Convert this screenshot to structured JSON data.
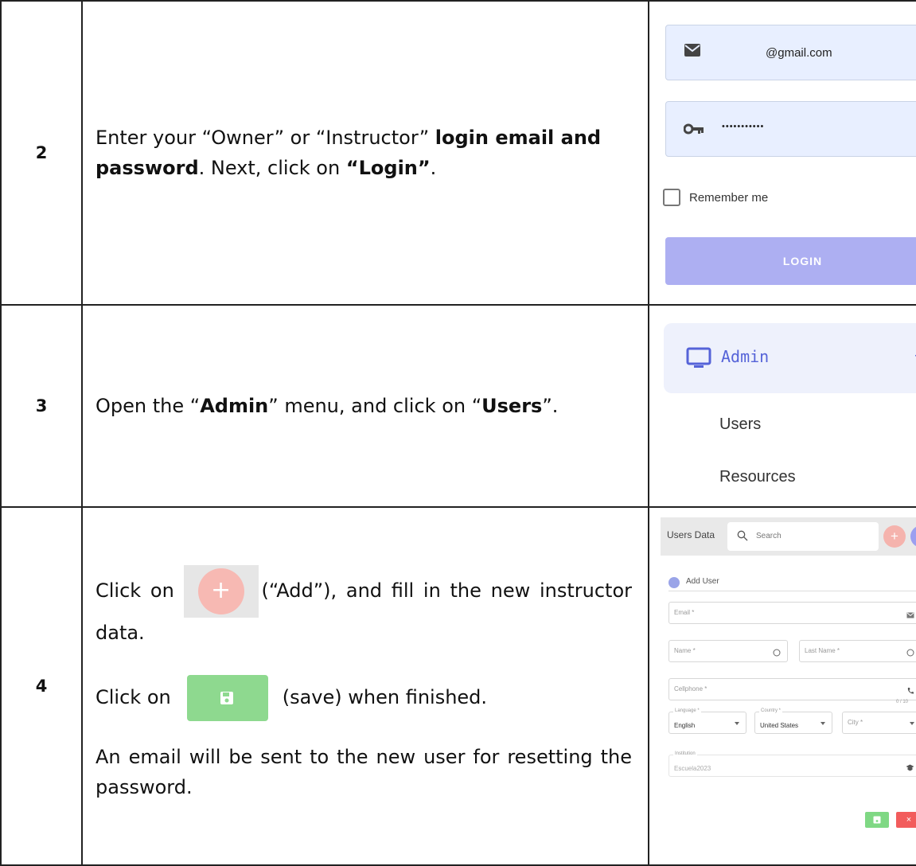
{
  "rows": [
    {
      "number": "2",
      "text": {
        "p1": "Enter your “Owner” or “Instructor” ",
        "p1_bold": "login email and password",
        "p2": ". Next, click on ",
        "p2_bold": "“Login”",
        "p3": "."
      },
      "login": {
        "email_value": "@gmail.com",
        "password_value": "•••••••••••",
        "remember_label": "Remember me",
        "login_label": "LOGIN"
      }
    },
    {
      "number": "3",
      "text": {
        "p1": "Open the “",
        "p1_bold": "Admin",
        "p2": "” menu, and click on “",
        "p2_bold": "Users",
        "p3": "”."
      },
      "menu": {
        "admin_label": "Admin",
        "collapse_symbol": "–",
        "items": [
          "Users",
          "Resources"
        ]
      }
    },
    {
      "number": "4",
      "text": {
        "click_on": "Click on",
        "add_suffix": "(“Add”), and fill in the new instructor data.",
        "click_on_2": "Click on",
        "save_suffix": "(save) when finished.",
        "email_note": "An email will be sent to the new user for resetting the password."
      },
      "dialog": {
        "header_title": "Users Data",
        "search_placeholder": "Search",
        "dialog_title": "Add User",
        "close_symbol": "×",
        "email_label": "Email *",
        "name_label": "Name *",
        "last_name_label": "Last Name *",
        "cellphone_label": "Cellphone *",
        "counter": "0 / 10",
        "language_label": "Language *",
        "language_value": "English",
        "country_label": "Country *",
        "country_value": "United States",
        "city_label": "City *",
        "institution_label": "Institution",
        "institution_value": "Escuela2023",
        "plus_symbol": "+",
        "refresh_symbol": "C",
        "cancel_symbol": "×"
      }
    }
  ]
}
